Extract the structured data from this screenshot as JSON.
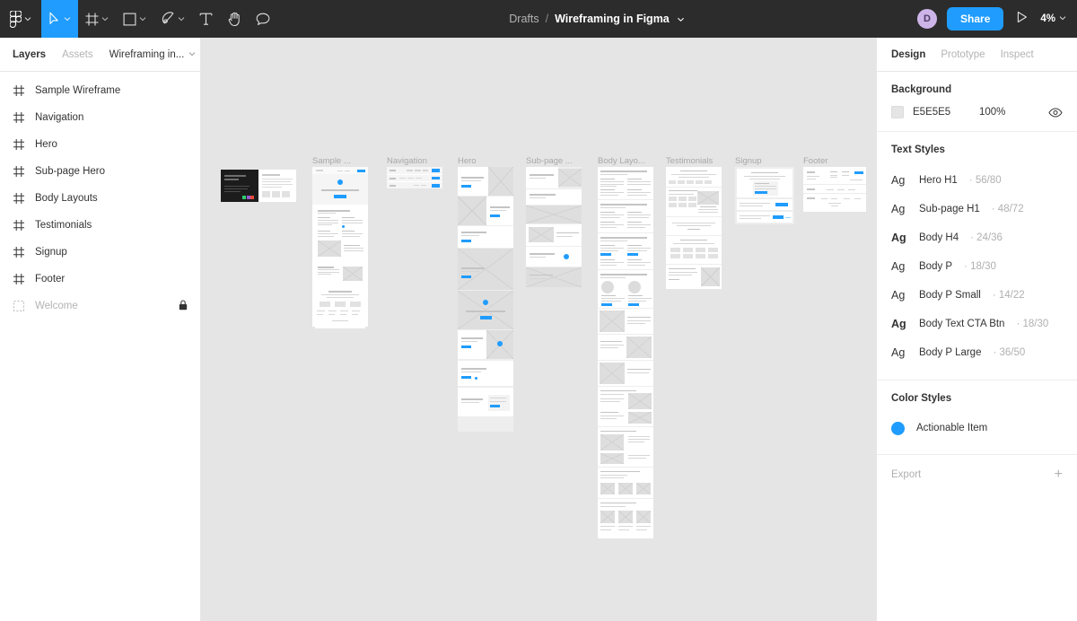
{
  "topbar": {
    "logo_icon": "figma-logo-icon",
    "tools": [
      {
        "name": "move-tool",
        "icon": "cursor-icon",
        "has_caret": true,
        "active": true
      },
      {
        "name": "frame-tool",
        "icon": "frame-icon",
        "has_caret": true,
        "active": false
      },
      {
        "name": "shape-tool",
        "icon": "square-icon",
        "has_caret": true,
        "active": false
      },
      {
        "name": "pen-tool",
        "icon": "pen-icon",
        "has_caret": true,
        "active": false
      },
      {
        "name": "text-tool",
        "icon": "text-icon",
        "has_caret": false,
        "active": false
      },
      {
        "name": "hand-tool",
        "icon": "hand-icon",
        "has_caret": false,
        "active": false
      },
      {
        "name": "comment-tool",
        "icon": "comment-icon",
        "has_caret": false,
        "active": false
      }
    ],
    "breadcrumb_project": "Drafts",
    "breadcrumb_sep": "/",
    "file_title": "Wireframing in Figma",
    "avatar_initial": "D",
    "share_label": "Share",
    "present_icon": "play-icon",
    "zoom_level": "4%",
    "accent_color": "#1f9cfd",
    "bar_color": "#2c2c2c",
    "avatar_color": "#cdb4e8"
  },
  "sidebar": {
    "tabs": [
      {
        "label": "Layers",
        "active": true
      },
      {
        "label": "Assets",
        "active": false
      }
    ],
    "page_selector": "Wireframing in...",
    "layers": [
      {
        "label": "Sample Wireframe",
        "icon": "frame-icon",
        "muted": false,
        "locked": false
      },
      {
        "label": "Navigation",
        "icon": "frame-icon",
        "muted": false,
        "locked": false
      },
      {
        "label": "Hero",
        "icon": "frame-icon",
        "muted": false,
        "locked": false
      },
      {
        "label": "Sub-page Hero",
        "icon": "frame-icon",
        "muted": false,
        "locked": false
      },
      {
        "label": "Body Layouts",
        "icon": "frame-icon",
        "muted": false,
        "locked": false
      },
      {
        "label": "Testimonials",
        "icon": "frame-icon",
        "muted": false,
        "locked": false
      },
      {
        "label": "Signup",
        "icon": "frame-icon",
        "muted": false,
        "locked": false
      },
      {
        "label": "Footer",
        "icon": "frame-icon",
        "muted": false,
        "locked": false
      },
      {
        "label": "Welcome",
        "icon": "slice-icon",
        "muted": true,
        "locked": true
      }
    ]
  },
  "canvas": {
    "background_color": "#e5e5e5",
    "cover_frame": {
      "title": "Wireframing in Figma"
    },
    "frames": [
      {
        "label": "Sample ...",
        "name": "sample-wireframe"
      },
      {
        "label": "Navigation",
        "name": "navigation"
      },
      {
        "label": "Hero",
        "name": "hero"
      },
      {
        "label": "Sub-page ...",
        "name": "sub-page-hero"
      },
      {
        "label": "Body Layo...",
        "name": "body-layouts"
      },
      {
        "label": "Testimonials",
        "name": "testimonials"
      },
      {
        "label": "Signup",
        "name": "signup"
      },
      {
        "label": "Footer",
        "name": "footer"
      }
    ]
  },
  "right_panel": {
    "tabs": [
      {
        "label": "Design",
        "active": true
      },
      {
        "label": "Prototype",
        "active": false
      },
      {
        "label": "Inspect",
        "active": false
      }
    ],
    "background": {
      "title": "Background",
      "hex": "E5E5E5",
      "opacity": "100%",
      "visibility_icon": "eye-icon",
      "swatch_color": "#e5e5e5"
    },
    "text_styles": {
      "title": "Text Styles",
      "items": [
        {
          "preview": "Ag",
          "name": "Hero H1",
          "meta": "· 56/80",
          "bold": false
        },
        {
          "preview": "Ag",
          "name": "Sub-page H1",
          "meta": "· 48/72",
          "bold": false
        },
        {
          "preview": "Ag",
          "name": "Body H4",
          "meta": "· 24/36",
          "bold": true
        },
        {
          "preview": "Ag",
          "name": "Body P",
          "meta": "· 18/30",
          "bold": false
        },
        {
          "preview": "Ag",
          "name": "Body P Small",
          "meta": "· 14/22",
          "bold": false
        },
        {
          "preview": "Ag",
          "name": "Body Text CTA Btn",
          "meta": "· 18/30",
          "bold": true
        },
        {
          "preview": "Ag",
          "name": "Body P Large",
          "meta": "· 36/50",
          "bold": false
        }
      ]
    },
    "color_styles": {
      "title": "Color Styles",
      "items": [
        {
          "name": "Actionable Item",
          "color": "#1f9cfd"
        }
      ]
    },
    "export": {
      "title": "Export",
      "add_icon": "plus-icon"
    }
  }
}
